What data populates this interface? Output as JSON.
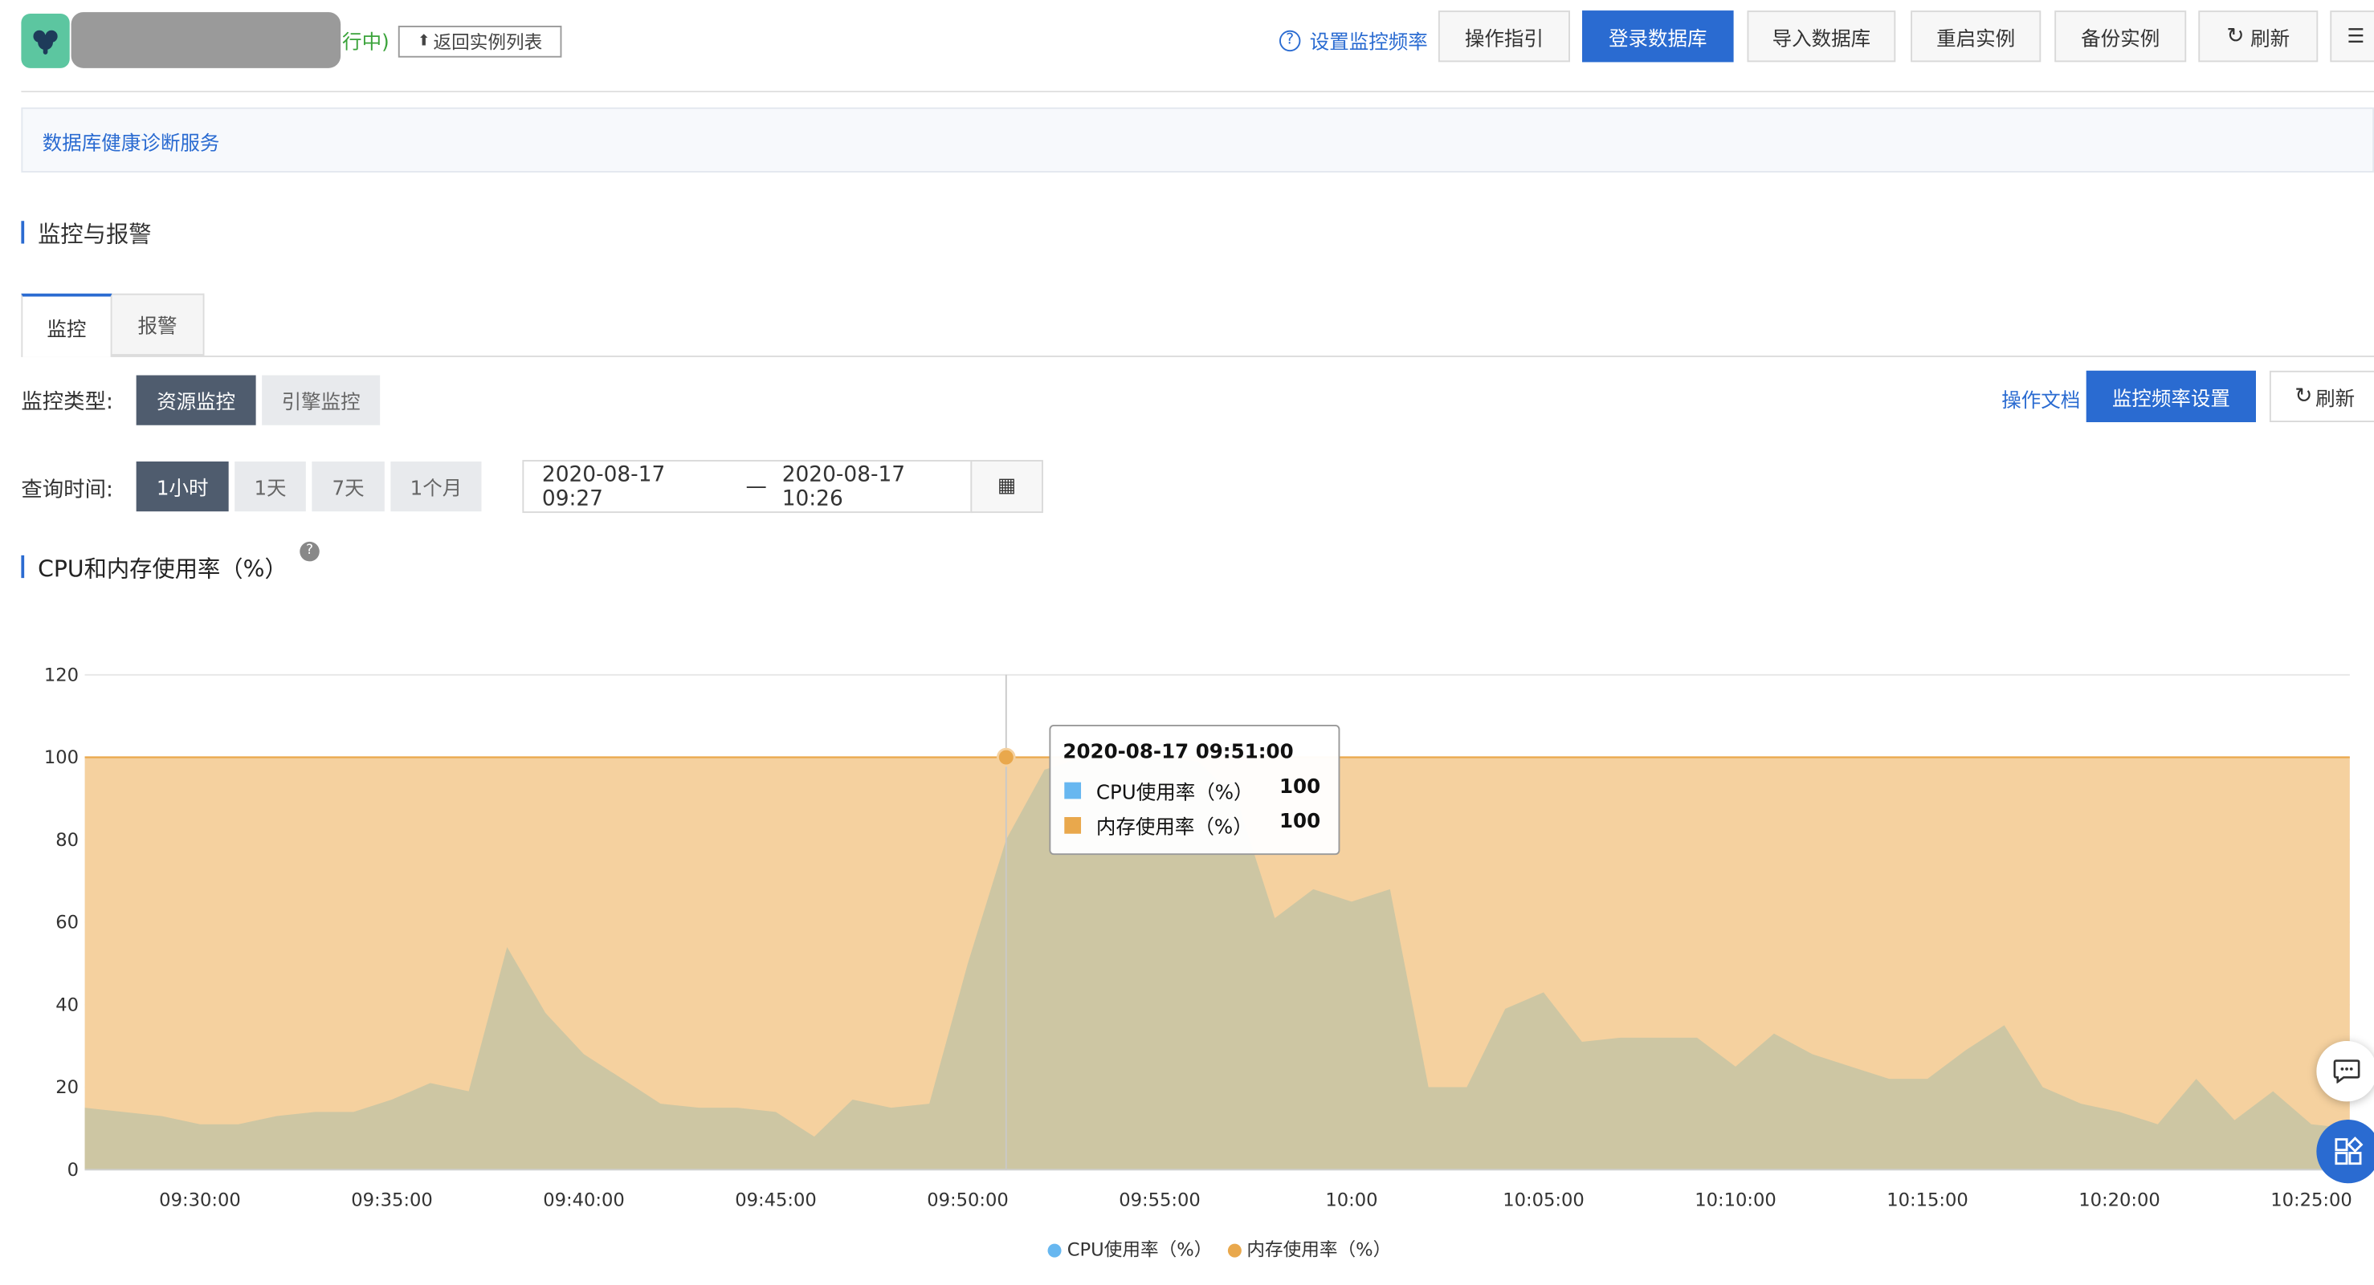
{
  "header": {
    "status_suffix": "行中)",
    "back_label": "返回实例列表",
    "monitor_freq_link": "设置监控频率",
    "buttons": {
      "guide": "操作指引",
      "login_db": "登录数据库",
      "import_db": "导入数据库",
      "restart": "重启实例",
      "backup": "备份实例",
      "refresh": "刷新"
    }
  },
  "notice": {
    "text": "数据库健康诊断服务"
  },
  "section_title": "监控与报警",
  "tabs": [
    {
      "label": "监控",
      "active": true
    },
    {
      "label": "报警",
      "active": false
    }
  ],
  "monitor_type": {
    "label": "监控类型:",
    "options": [
      {
        "label": "资源监控",
        "active": true
      },
      {
        "label": "引擎监控",
        "active": false
      }
    ],
    "doc_link": "操作文档",
    "freq_button": "监控频率设置",
    "refresh": "刷新"
  },
  "query_time": {
    "label": "查询时间:",
    "ranges": [
      {
        "label": "1小时",
        "active": true
      },
      {
        "label": "1天",
        "active": false
      },
      {
        "label": "7天",
        "active": false
      },
      {
        "label": "1个月",
        "active": false
      }
    ],
    "start": "2020-08-17 09:27",
    "separator": "—",
    "end": "2020-08-17 10:26"
  },
  "chart_title": "CPU和内存使用率（%）",
  "colors": {
    "accent": "#2a6bd1",
    "cpu": "#67b7f0",
    "mem": "#e9a84c",
    "mem_fill": "#f5d19f",
    "cpu_fill": "#cdc6a3"
  },
  "chart_data": {
    "type": "area",
    "xlabel": "",
    "ylabel": "",
    "ylim": [
      0,
      120
    ],
    "y_ticks": [
      0,
      20,
      40,
      60,
      80,
      100,
      120
    ],
    "x_tick_labels": [
      "09:30:00",
      "09:35:00",
      "09:40:00",
      "09:45:00",
      "09:50:00",
      "09:55:00",
      "10:00",
      "10:05:00",
      "10:10:00",
      "10:15:00",
      "10:20:00",
      "10:25:00"
    ],
    "x_minutes": [
      27,
      28,
      29,
      30,
      31,
      32,
      33,
      34,
      35,
      36,
      37,
      38,
      39,
      40,
      41,
      42,
      43,
      44,
      45,
      46,
      47,
      48,
      49,
      50,
      51,
      52,
      53,
      54,
      55,
      56,
      57,
      58,
      59,
      60,
      61,
      62,
      63,
      64,
      65,
      66,
      67,
      68,
      69,
      70,
      71,
      72,
      73,
      74,
      75,
      76,
      77,
      78,
      79,
      80,
      81,
      82,
      83,
      84,
      85,
      86
    ],
    "grid": true,
    "legend_position": "bottom-center",
    "series": [
      {
        "name": "CPU使用率（%）",
        "values": [
          15,
          14,
          13,
          11,
          11,
          13,
          14,
          14,
          17,
          21,
          19,
          54,
          38,
          28,
          22,
          16,
          15,
          15,
          14,
          8,
          17,
          15,
          16,
          50,
          80,
          97,
          100,
          100,
          100,
          99,
          90,
          61,
          68,
          65,
          68,
          20,
          20,
          39,
          43,
          31,
          32,
          32,
          32,
          25,
          33,
          28,
          25,
          22,
          22,
          29,
          35,
          20,
          16,
          14,
          11,
          22,
          12,
          19,
          11,
          10
        ]
      },
      {
        "name": "内存使用率（%）",
        "values": [
          100,
          100,
          100,
          100,
          100,
          100,
          100,
          100,
          100,
          100,
          100,
          100,
          100,
          100,
          100,
          100,
          100,
          100,
          100,
          100,
          100,
          100,
          100,
          100,
          100,
          100,
          100,
          100,
          100,
          100,
          100,
          100,
          100,
          100,
          100,
          100,
          100,
          100,
          100,
          100,
          100,
          100,
          100,
          100,
          100,
          100,
          100,
          100,
          100,
          100,
          100,
          100,
          100,
          100,
          100,
          100,
          100,
          100,
          100,
          100
        ]
      }
    ],
    "tooltip": {
      "title": "2020-08-17 09:51:00",
      "rows": [
        {
          "name": "CPU使用率（%）",
          "value": "100"
        },
        {
          "name": "内存使用率（%）",
          "value": "100"
        }
      ]
    }
  }
}
